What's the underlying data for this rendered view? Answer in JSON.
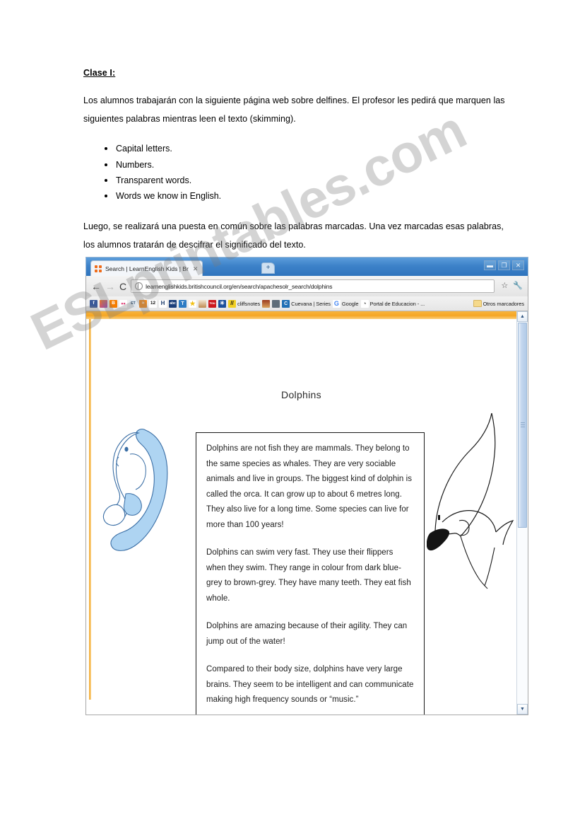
{
  "worksheet": {
    "heading": "Clase I:",
    "intro": "Los alumnos trabajarán con la siguiente página web sobre delfines. El profesor les pedirá que marquen las siguientes palabras mientras leen el texto (skimming).",
    "bullets": [
      "Capital letters.",
      "Numbers.",
      "Transparent words.",
      "Words we know in English."
    ],
    "outro": "Luego, se realizará una puesta en común sobre las palabras marcadas. Una vez marcadas esas palabras, los alumnos tratarán de descifrar el significado del texto."
  },
  "browser": {
    "tab": {
      "title": "Search | LearnEnglish Kids | Br",
      "close_label": "✕",
      "favicon": "british-council-icon"
    },
    "new_tab_label": "+",
    "window_controls": {
      "minimize": "▬",
      "maximize": "❐",
      "close": "✕"
    },
    "toolbar": {
      "back": "←",
      "forward": "→",
      "reload": "C",
      "url": "learnenglishkids.britishcouncil.org/en/search/apachesolr_search/dolphins",
      "star": "☆",
      "wrench": "🔧"
    },
    "bookmarks": [
      {
        "label": "",
        "letter": "f",
        "color": "#3b5998",
        "name": "facebook"
      },
      {
        "label": "",
        "letter": "",
        "color": "#e8752a",
        "name": "colorful"
      },
      {
        "label": "",
        "letter": "B",
        "color": "#f57d00",
        "name": "blogger"
      },
      {
        "label": "",
        "letter": "••",
        "color": "#ffffff",
        "name": "dots"
      },
      {
        "label": "",
        "letter": "ET",
        "color": "#dfe7ee",
        "name": "et"
      },
      {
        "label": "",
        "letter": "≈",
        "color": "#f08a1c",
        "name": "rss"
      },
      {
        "label": "",
        "letter": "12",
        "color": "#ffffff",
        "name": "twelve"
      },
      {
        "label": "",
        "letter": "H",
        "color": "#ffffff",
        "name": "h"
      },
      {
        "label": "",
        "letter": "abc",
        "color": "#1b3f7a",
        "name": "abc"
      },
      {
        "label": "",
        "letter": "T",
        "color": "#2d7cc4",
        "name": "t"
      },
      {
        "label": "",
        "letter": "★",
        "color": "#ffffff",
        "name": "star-yellow"
      },
      {
        "label": "",
        "letter": "",
        "color": "#f2e6d2",
        "name": "person"
      },
      {
        "label": "",
        "letter": "You",
        "color": "#cc181e",
        "name": "youtube"
      },
      {
        "label": "",
        "letter": "✳",
        "color": "#1b4f9c",
        "name": "asterisk"
      },
      {
        "label": "cliffsnotes",
        "letter": "//",
        "color": "#f2d024",
        "name": "cliffsnotes"
      },
      {
        "label": "",
        "letter": "",
        "color": "#9b3a1f",
        "name": "red-brown"
      },
      {
        "label": "",
        "letter": "",
        "color": "#5e6d7a",
        "name": "grey"
      },
      {
        "label": "Cuevana | Series",
        "letter": "C",
        "color": "#1f6fb5",
        "name": "cuevana"
      },
      {
        "label": "Google",
        "letter": "G",
        "color": "#ffffff",
        "name": "google"
      },
      {
        "label": "Portal de Educacion - ...",
        "letter": "◔",
        "color": "#ffffff",
        "name": "portal-educacion"
      }
    ],
    "other_bookmarks": "Otros marcadores"
  },
  "page": {
    "heading": "Dolphins",
    "paragraphs": [
      "Dolphins are not fish they are mammals. They belong to the same species as whales. They are very sociable animals and live in groups. The biggest kind of dolphin is called the orca. It can grow up to about 6 metres long. They also live for a long time. Some species can live for more than 100 years!",
      "Dolphins can swim very fast. They use their flippers when they swim. They range in colour from dark blue-grey to brown-grey. They have many teeth. They eat fish whole.",
      "Dolphins are amazing because of their agility. They can jump out of the water!",
      "Compared to their body size, dolphins have very large brains. They seem to be intelligent and can communicate making high frequency sounds or “music.”"
    ],
    "scrollbar": {
      "up_arrow": "▲",
      "down_arrow": "▼"
    },
    "accent_color": "#f5a623"
  },
  "watermark": {
    "text": "ESLprintables.com"
  }
}
